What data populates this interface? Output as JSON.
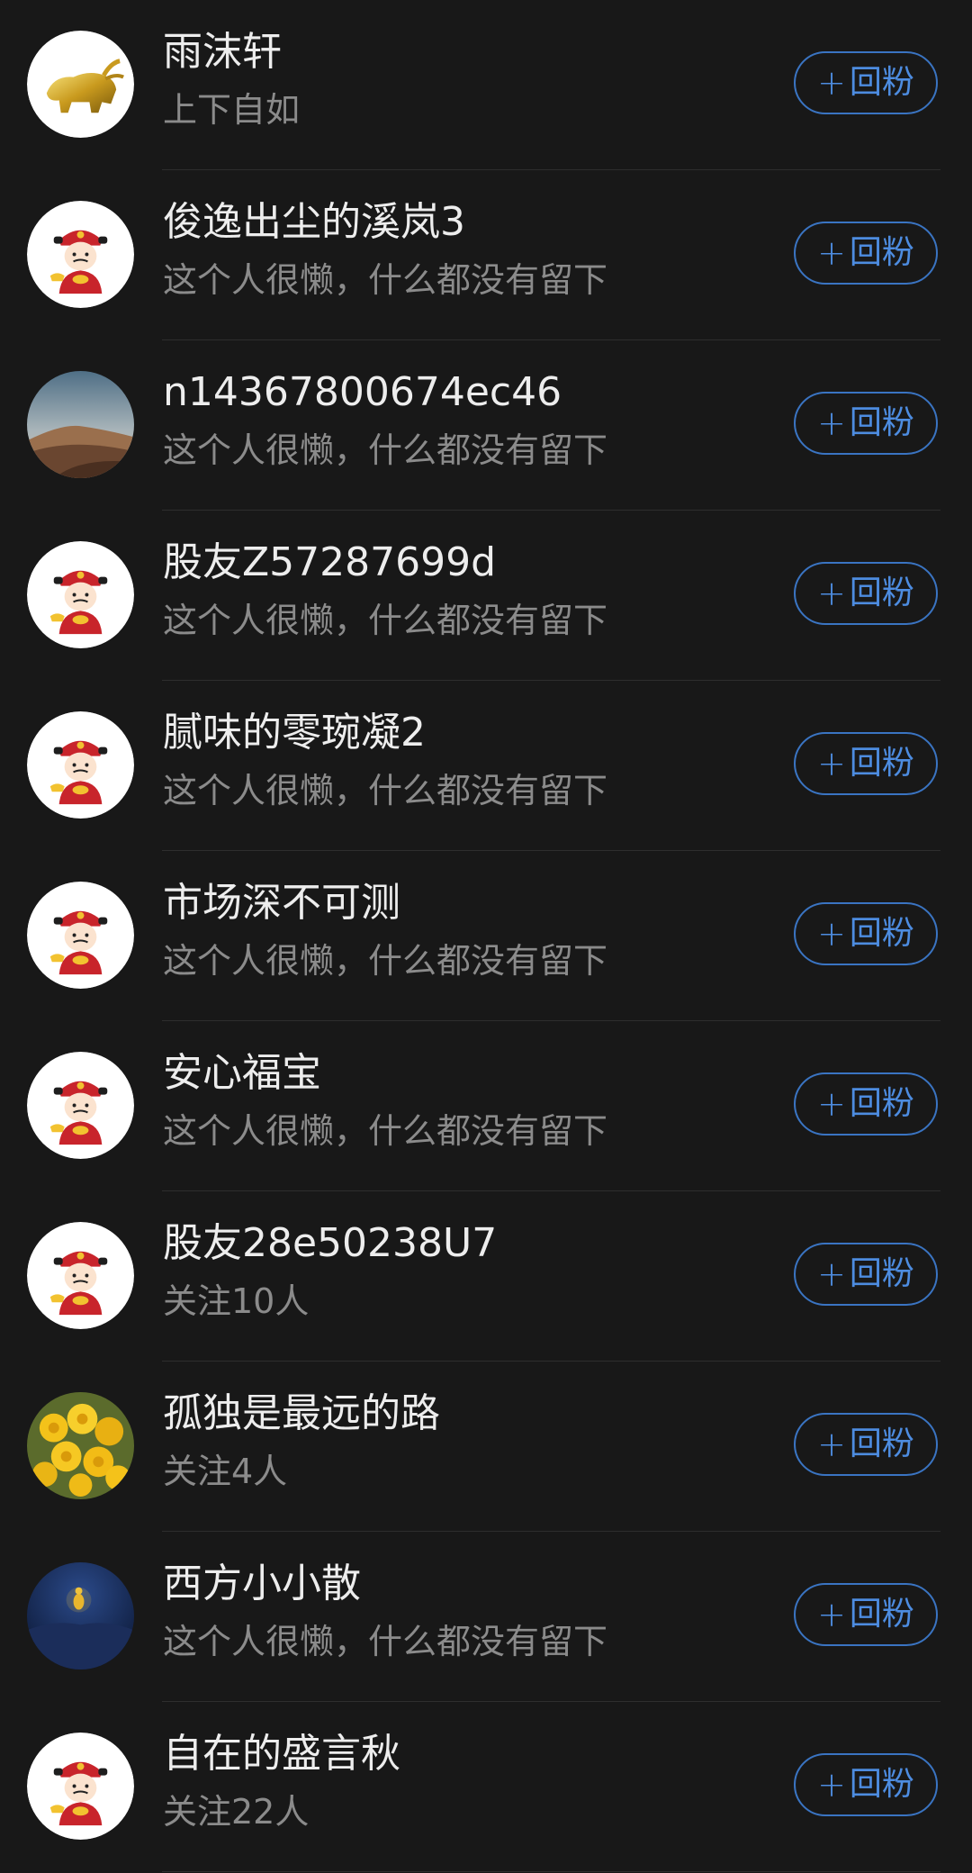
{
  "colors": {
    "background": "#181818",
    "name_text": "#ededed",
    "sub_text": "#8b8b8b",
    "accent": "#4d8ce0",
    "divider": "#2e2e2e"
  },
  "follow_button": {
    "plus_icon": "plus-icon",
    "label": "回粉"
  },
  "users": [
    {
      "name": "雨沫轩",
      "subtitle": "上下自如",
      "avatar": "golden-bull"
    },
    {
      "name": "俊逸出尘的溪岚3",
      "subtitle": "这个人很懒，什么都没有留下",
      "avatar": "fortune-god"
    },
    {
      "name": "n14367800674ec46",
      "subtitle": "这个人很懒，什么都没有留下",
      "avatar": "desert-dunes"
    },
    {
      "name": "股友Z57287699d",
      "subtitle": "这个人很懒，什么都没有留下",
      "avatar": "fortune-god"
    },
    {
      "name": "腻味的零琬凝2",
      "subtitle": "这个人很懒，什么都没有留下",
      "avatar": "fortune-god"
    },
    {
      "name": "市场深不可测",
      "subtitle": "这个人很懒，什么都没有留下",
      "avatar": "fortune-god"
    },
    {
      "name": "安心福宝",
      "subtitle": "这个人很懒，什么都没有留下",
      "avatar": "fortune-god"
    },
    {
      "name": "股友28e50238U7",
      "subtitle": "关注10人",
      "avatar": "fortune-god"
    },
    {
      "name": "孤独是最远的路",
      "subtitle": "关注4人",
      "avatar": "yellow-roses"
    },
    {
      "name": "西方小小散",
      "subtitle": "这个人很懒，什么都没有留下",
      "avatar": "night-buddha"
    },
    {
      "name": "自在的盛言秋",
      "subtitle": "关注22人",
      "avatar": "fortune-god"
    }
  ]
}
